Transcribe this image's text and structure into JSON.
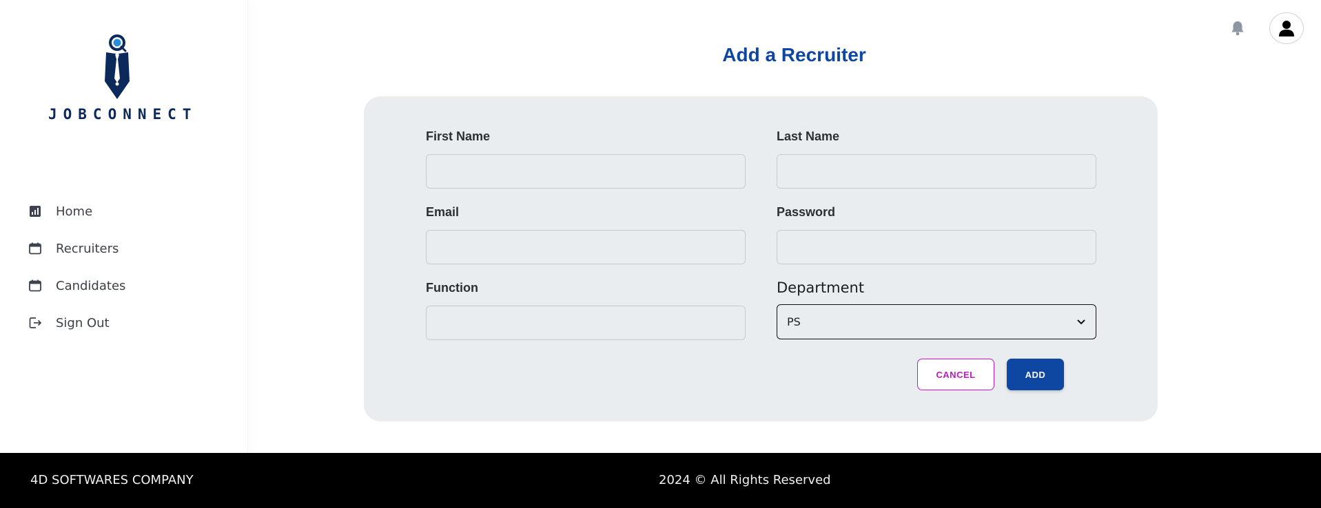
{
  "brand": {
    "name": "JOBCONNECT",
    "navy": "#0b2a5b",
    "accent": "#0e47a1",
    "magenta": "#c21ac0"
  },
  "sidebar": {
    "items": [
      {
        "label": "Home",
        "icon": "bar-chart-icon"
      },
      {
        "label": "Recruiters",
        "icon": "calendar-icon"
      },
      {
        "label": "Candidates",
        "icon": "calendar-icon"
      },
      {
        "label": "Sign Out",
        "icon": "sign-out-icon"
      }
    ]
  },
  "header": {
    "icons": [
      "bell-icon",
      "user-avatar-icon"
    ]
  },
  "page": {
    "title": "Add a Recruiter"
  },
  "form": {
    "first_name": {
      "label": "First Name",
      "value": ""
    },
    "last_name": {
      "label": "Last Name",
      "value": ""
    },
    "email": {
      "label": "Email",
      "value": ""
    },
    "password": {
      "label": "Password",
      "value": ""
    },
    "function": {
      "label": "Function",
      "value": ""
    },
    "department": {
      "label": "Department",
      "selected": "PS"
    },
    "cancel_label": "CANCEL",
    "add_label": "ADD"
  },
  "footer": {
    "company": "4D SOFTWARES COMPANY",
    "copyright": "2024 © All Rights Reserved"
  }
}
